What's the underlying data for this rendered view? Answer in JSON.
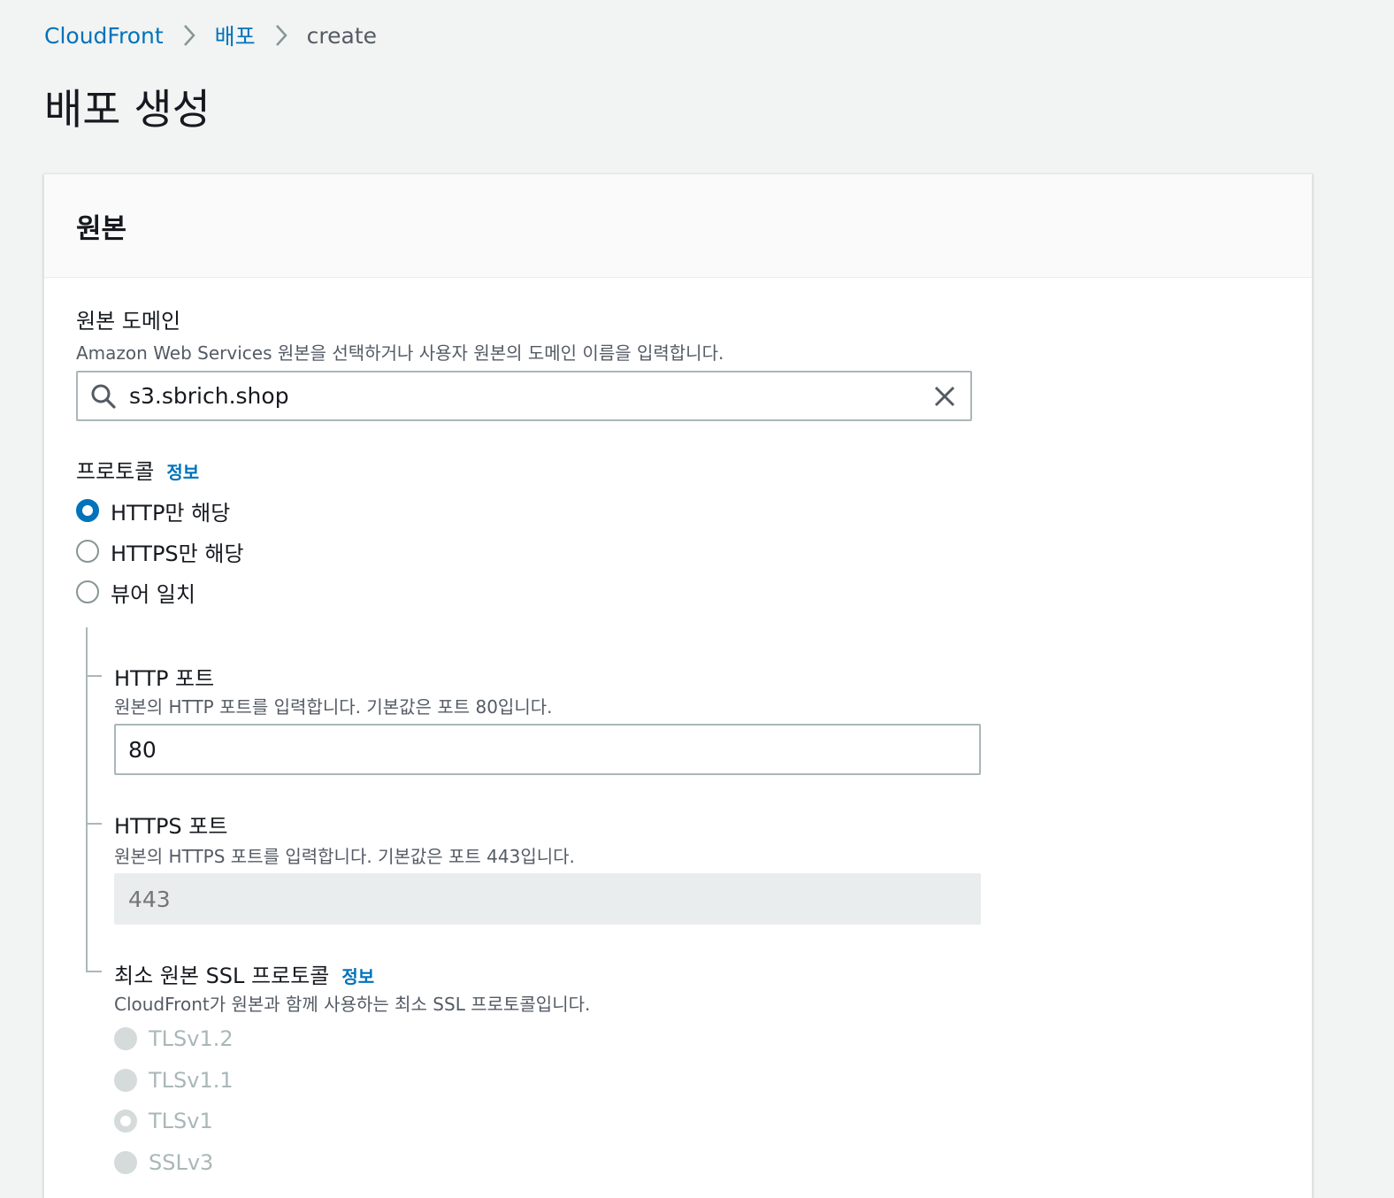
{
  "breadcrumb": {
    "items": [
      {
        "label": "CloudFront"
      },
      {
        "label": "배포"
      },
      {
        "label": "create"
      }
    ]
  },
  "page": {
    "title": "배포 생성"
  },
  "origin": {
    "title": "원본",
    "domain": {
      "label": "원본 도메인",
      "description": "Amazon Web Services 원본을 선택하거나 사용자 원본의 도메인 이름을 입력합니다.",
      "value": "s3.sbrich.shop"
    },
    "protocol": {
      "label": "프로토콜",
      "info": "정보",
      "options": [
        {
          "label": "HTTP만 해당",
          "selected": true
        },
        {
          "label": "HTTPS만 해당",
          "selected": false
        },
        {
          "label": "뷰어 일치",
          "selected": false
        }
      ]
    },
    "http_port": {
      "label": "HTTP 포트",
      "description": "원본의 HTTP 포트를 입력합니다. 기본값은 포트 80입니다.",
      "value": "80"
    },
    "https_port": {
      "label": "HTTPS 포트",
      "description": "원본의 HTTPS 포트를 입력합니다. 기본값은 포트 443입니다.",
      "placeholder": "443"
    },
    "ssl": {
      "label": "최소 원본 SSL 프로토콜",
      "info": "정보",
      "description": "CloudFront가 원본과 함께 사용하는 최소 SSL 프로토콜입니다.",
      "options": [
        {
          "label": "TLSv1.2",
          "selected": false
        },
        {
          "label": "TLSv1.1",
          "selected": false
        },
        {
          "label": "TLSv1",
          "selected": true
        },
        {
          "label": "SSLv3",
          "selected": false
        }
      ]
    }
  },
  "colors": {
    "link": "#0073bb",
    "background": "#f2f3f3",
    "text": "#16191f",
    "muted": "#545b64"
  }
}
